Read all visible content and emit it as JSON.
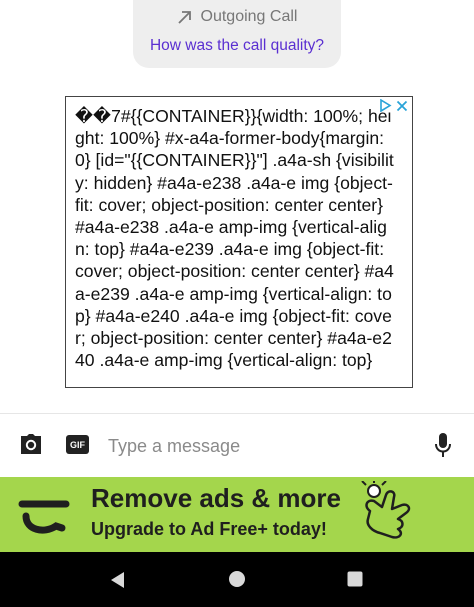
{
  "call_card": {
    "title": "Outgoing Call",
    "icon": "outgoing-arrow-icon",
    "question_link": "How was the call quality?"
  },
  "ad": {
    "raw_text": "�⁣�7#{{CONTAINER}}{width: 100%; height: 100%} #x-a4a-former-body{margin: 0} [id=\"{{CONTAINER}}\"] .a4a-sh {visibility: hidden} #a4a-e238 .a4a-e img {object-fit: cover; object-position: center center} #a4a-e238 .a4a-e amp-img {vertical-align: top} #a4a-e239 .a4a-e img {object-fit: cover; object-position: center center} #a4a-e239 .a4a-e amp-img {vertical-align: top} #a4a-e240 .a4a-e img {object-fit: cover; object-position: center center} #a4a-e240 .a4a-e amp-img {vertical-align: top}",
    "choices_icon": "adchoices-icon",
    "close_icon": "close-icon"
  },
  "composer": {
    "camera_icon": "camera-icon",
    "gif_label": "GIF",
    "placeholder": "Type a message",
    "mic_icon": "microphone-icon"
  },
  "promo_banner": {
    "title": "Remove ads & more",
    "subtitle": "Upgrade to Ad Free+ today!",
    "background_color": "#a4d64c"
  },
  "nav_bar": {
    "back_icon": "back-triangle-icon",
    "home_icon": "home-circle-icon",
    "recents_icon": "recents-square-icon"
  },
  "colors": {
    "accent_link": "#5a2fd1",
    "banner_green": "#a4d64c"
  }
}
